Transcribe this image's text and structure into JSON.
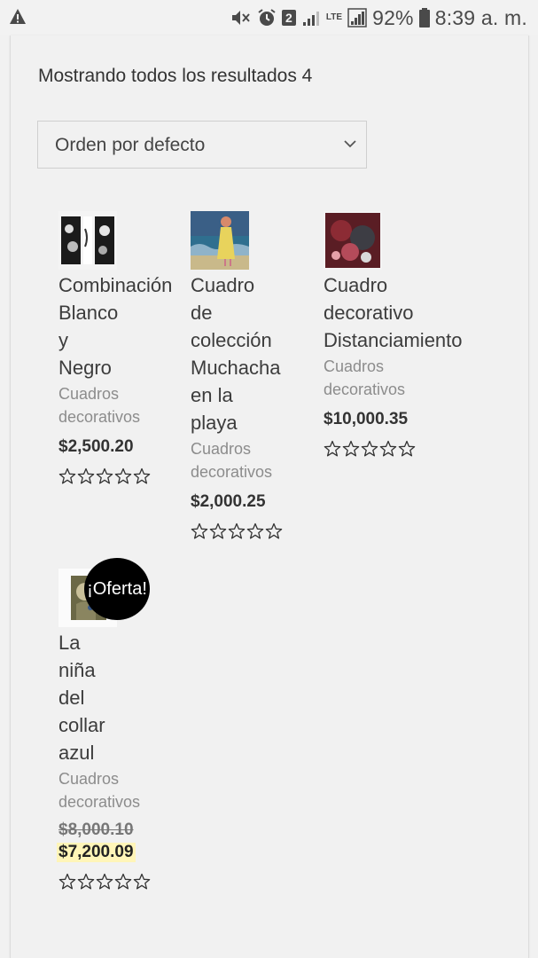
{
  "status_bar": {
    "battery": "92%",
    "time": "8:39 a. m.",
    "sim_slot": "2",
    "network": "LTE",
    "icons": [
      "warning-icon",
      "mute-vibrate-icon",
      "alarm-icon",
      "sim-2-icon",
      "signal-icon",
      "lte-icon",
      "signal-icon",
      "battery-icon"
    ]
  },
  "shop": {
    "results_count": "Mostrando todos los resultados 4",
    "orderby_selected": "Orden por defecto"
  },
  "products": [
    {
      "title_lines": [
        "Combinación",
        "Blanco",
        "y",
        "Negro"
      ],
      "category_lines": [
        "Cuadros",
        "decorativos"
      ],
      "price": "$2,500.20",
      "rating_stars": 0
    },
    {
      "title_lines": [
        "Cuadro",
        "de",
        "colección",
        "Muchacha",
        "en la",
        "playa"
      ],
      "category_lines": [
        "Cuadros",
        "decorativos"
      ],
      "price": "$2,000.25",
      "rating_stars": 0
    },
    {
      "title_lines": [
        "Cuadro",
        "decorativo",
        "Distanciamiento"
      ],
      "category_lines": [
        "Cuadros",
        "decorativos"
      ],
      "price": "$10,000.35",
      "rating_stars": 0
    },
    {
      "title_lines": [
        "La",
        "niña",
        "del",
        "collar",
        "azul"
      ],
      "category_lines": [
        "Cuadros",
        "decorativos"
      ],
      "regular_price": "$8,000.10",
      "sale_price": "$7,200.09",
      "sale_badge": "¡Oferta!",
      "rating_stars": 0
    }
  ],
  "colors": {
    "background": "#f1f1f1",
    "sale_highlight": "#fff5b8",
    "badge": "#000000"
  }
}
